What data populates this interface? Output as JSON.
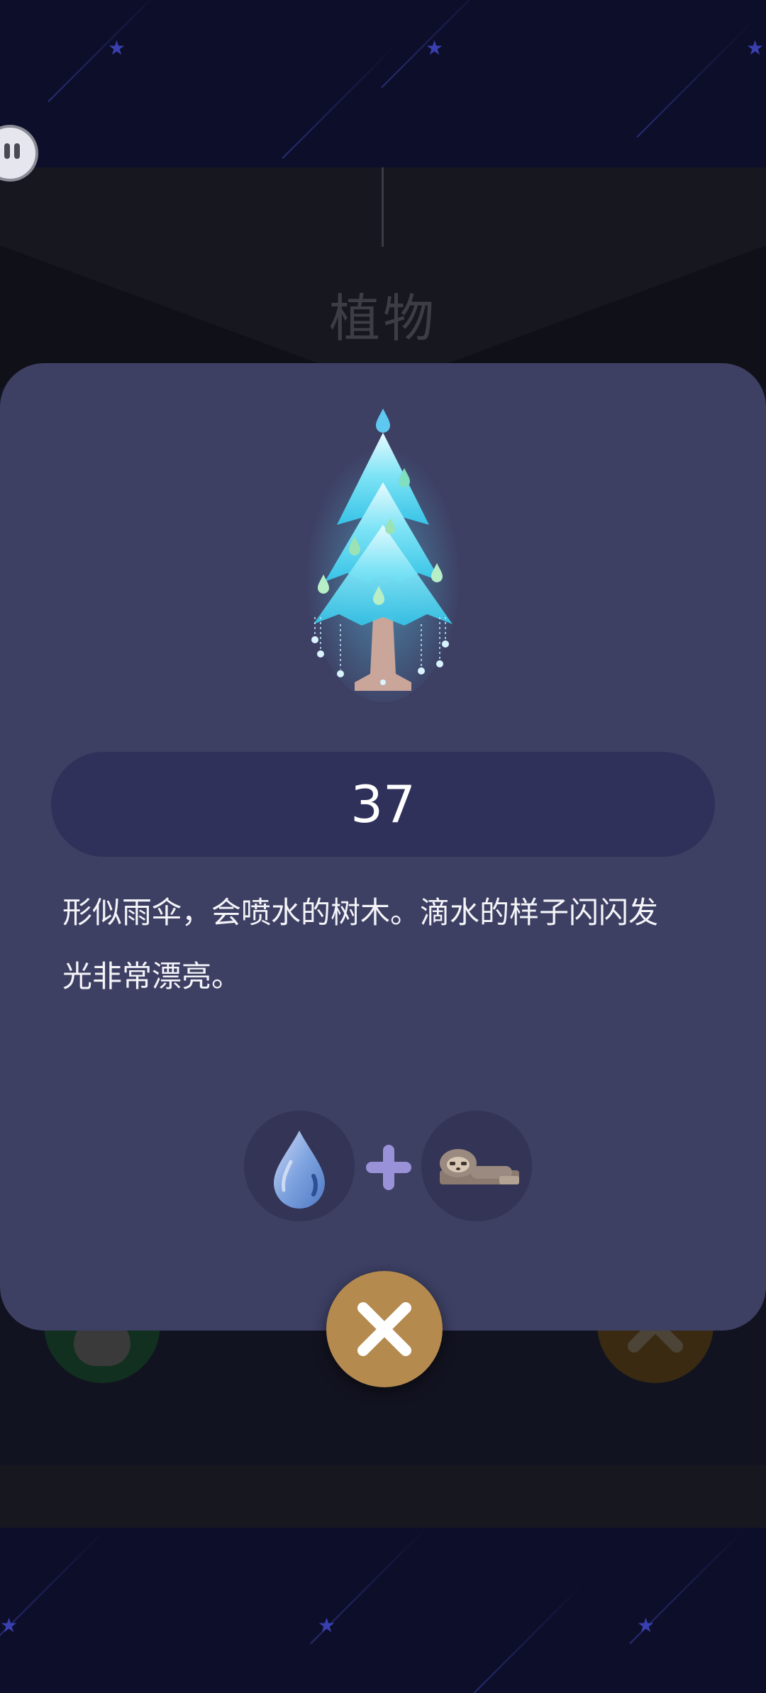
{
  "header": {
    "title": "植物"
  },
  "card": {
    "count": "37",
    "description_line1": "形似雨伞，会喷水的树木。滴水的样子闪闪发",
    "description_line2": "光非常漂亮。",
    "recipe": {
      "ingredient_1": "water-drop-icon",
      "ingredient_2": "sloth-icon",
      "operator": "+"
    }
  },
  "colors": {
    "card": "#3d3f63",
    "pill": "#30315a",
    "close_button": "#b48a4e",
    "plus": "#9a92d8"
  }
}
